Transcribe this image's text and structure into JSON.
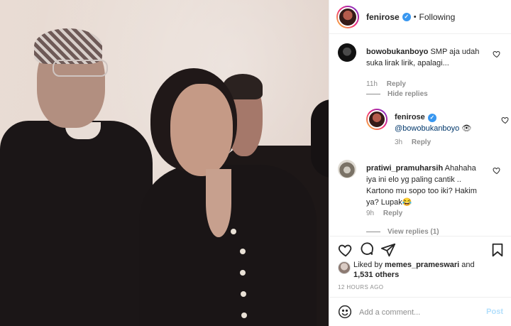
{
  "header": {
    "username": "fenirose",
    "separator": "•",
    "follow_status": "Following"
  },
  "comments": [
    {
      "username": "bowobukanboyo",
      "text": "SMP aja udah suka lirak lirik, apalagi...",
      "time": "11h",
      "reply": "Reply"
    },
    {
      "hide_replies": "Hide replies"
    },
    {
      "username": "fenirose",
      "mention": "@bowobukanboyo",
      "emoji": "👁",
      "time": "3h",
      "reply": "Reply"
    },
    {
      "username": "pratiwi_pramuharsih",
      "text": "Ahahaha iya ini elo yg paling cantik .. Kartono mu sopo too iki? Hakim ya? Lupak😂",
      "time": "9h",
      "reply": "Reply"
    },
    {
      "view_replies": "View replies (1)"
    }
  ],
  "likes": {
    "prefix": "Liked by",
    "user": "memes_prameswari",
    "and": "and",
    "count": "1,531 others"
  },
  "timestamp": "12 HOURS AGO",
  "add_comment": {
    "placeholder": "Add a comment...",
    "post_label": "Post"
  },
  "icons": [
    "heart-icon",
    "comment-icon",
    "share-icon",
    "bookmark-icon",
    "emoji-icon",
    "verified-icon"
  ],
  "colors": {
    "verified": "#3897f0",
    "post_disabled": "#b2dffc",
    "meta_gray": "#8e8e8e",
    "mention": "#00376b"
  }
}
